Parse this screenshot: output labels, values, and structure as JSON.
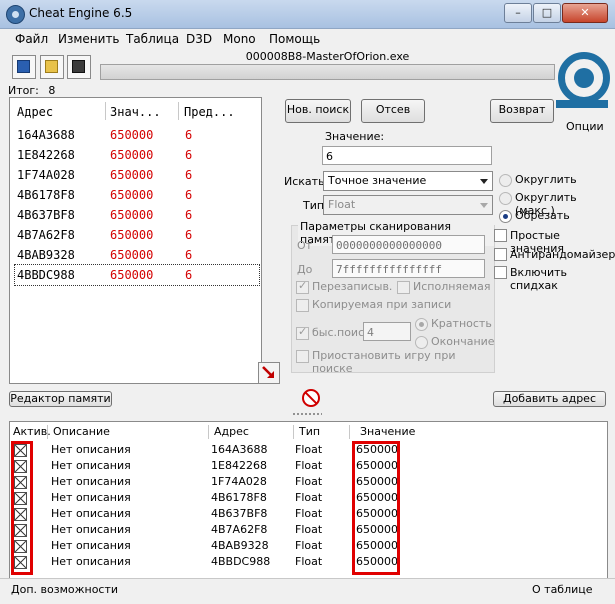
{
  "window": {
    "title": "Cheat Engine 6.5",
    "min_glyph": "–",
    "max_glyph": "□",
    "close_glyph": "✕"
  },
  "menu": [
    "Файл",
    "Изменить",
    "Таблица",
    "D3D",
    "Mono",
    "Помощь"
  ],
  "process_name": "000008B8-MasterOfOrion.exe",
  "found": {
    "label": "Итог:",
    "count": "8"
  },
  "results": {
    "headers": [
      "Адрес",
      "Знач...",
      "Пред..."
    ],
    "rows": [
      {
        "address": "164A3688",
        "value": "650000",
        "previous": "6"
      },
      {
        "address": "1E842268",
        "value": "650000",
        "previous": "6"
      },
      {
        "address": "1F74A028",
        "value": "650000",
        "previous": "6"
      },
      {
        "address": "4B6178F8",
        "value": "650000",
        "previous": "6"
      },
      {
        "address": "4B637BF8",
        "value": "650000",
        "previous": "6"
      },
      {
        "address": "4B7A62F8",
        "value": "650000",
        "previous": "6"
      },
      {
        "address": "4BAB9328",
        "value": "650000",
        "previous": "6"
      },
      {
        "address": "4BBDC988",
        "value": "650000",
        "previous": "6"
      }
    ]
  },
  "buttons": {
    "new_scan": "Нов. поиск",
    "next_scan": "Отсев",
    "undo_scan": "Возврат",
    "settings": "Опции",
    "memory_view": "Редактор памяти",
    "add_address": "Добавить адрес"
  },
  "value_label": "Значение:",
  "value_input": "6",
  "scan_type": {
    "label": "Искать",
    "selected": "Точное значение"
  },
  "value_type": {
    "label": "Тип",
    "selected": "Float"
  },
  "mem_options": {
    "title": "Параметры сканирования памяти",
    "from_label": "От",
    "from_value": "0000000000000000",
    "to_label": "До",
    "to_value": "7fffffffffffffff",
    "writable": "Перезаписыв.",
    "executable": "Исполняемая",
    "copy_on_write": "Копируемая при записи",
    "fast_scan": "быс.поиск",
    "fast_scan_value": "4",
    "alignment": "Кратность",
    "last_digits": "Окончание",
    "pause_game": "Приостановить игру при поиске"
  },
  "rounding": {
    "rounded": "Округлить",
    "rounded_extreme": "Округлить (макс.)",
    "truncated": "Обрезать"
  },
  "extra_options": {
    "simple_values": "Простые значения",
    "unrandomizer": "Антирандомайзер",
    "speedhack": "Включить спидхак"
  },
  "address_table": {
    "headers": {
      "active": "Актив.",
      "description": "Описание",
      "address": "Адрес",
      "type": "Тип",
      "value": "Значение"
    },
    "rows": [
      {
        "description": "Нет описания",
        "address": "164A3688",
        "type": "Float",
        "value": "650000"
      },
      {
        "description": "Нет описания",
        "address": "1E842268",
        "type": "Float",
        "value": "650000"
      },
      {
        "description": "Нет описания",
        "address": "1F74A028",
        "type": "Float",
        "value": "650000"
      },
      {
        "description": "Нет описания",
        "address": "4B6178F8",
        "type": "Float",
        "value": "650000"
      },
      {
        "description": "Нет описания",
        "address": "4B637BF8",
        "type": "Float",
        "value": "650000"
      },
      {
        "description": "Нет описания",
        "address": "4B7A62F8",
        "type": "Float",
        "value": "650000"
      },
      {
        "description": "Нет описания",
        "address": "4BAB9328",
        "type": "Float",
        "value": "650000"
      },
      {
        "description": "Нет описания",
        "address": "4BBDC988",
        "type": "Float",
        "value": "650000"
      }
    ]
  },
  "status": {
    "left": "Доп. возможности",
    "right": "О таблице"
  },
  "colors": {
    "value_red": "#d40000",
    "highlight": "#e00000",
    "logo_blue": "#1f6fa3"
  }
}
